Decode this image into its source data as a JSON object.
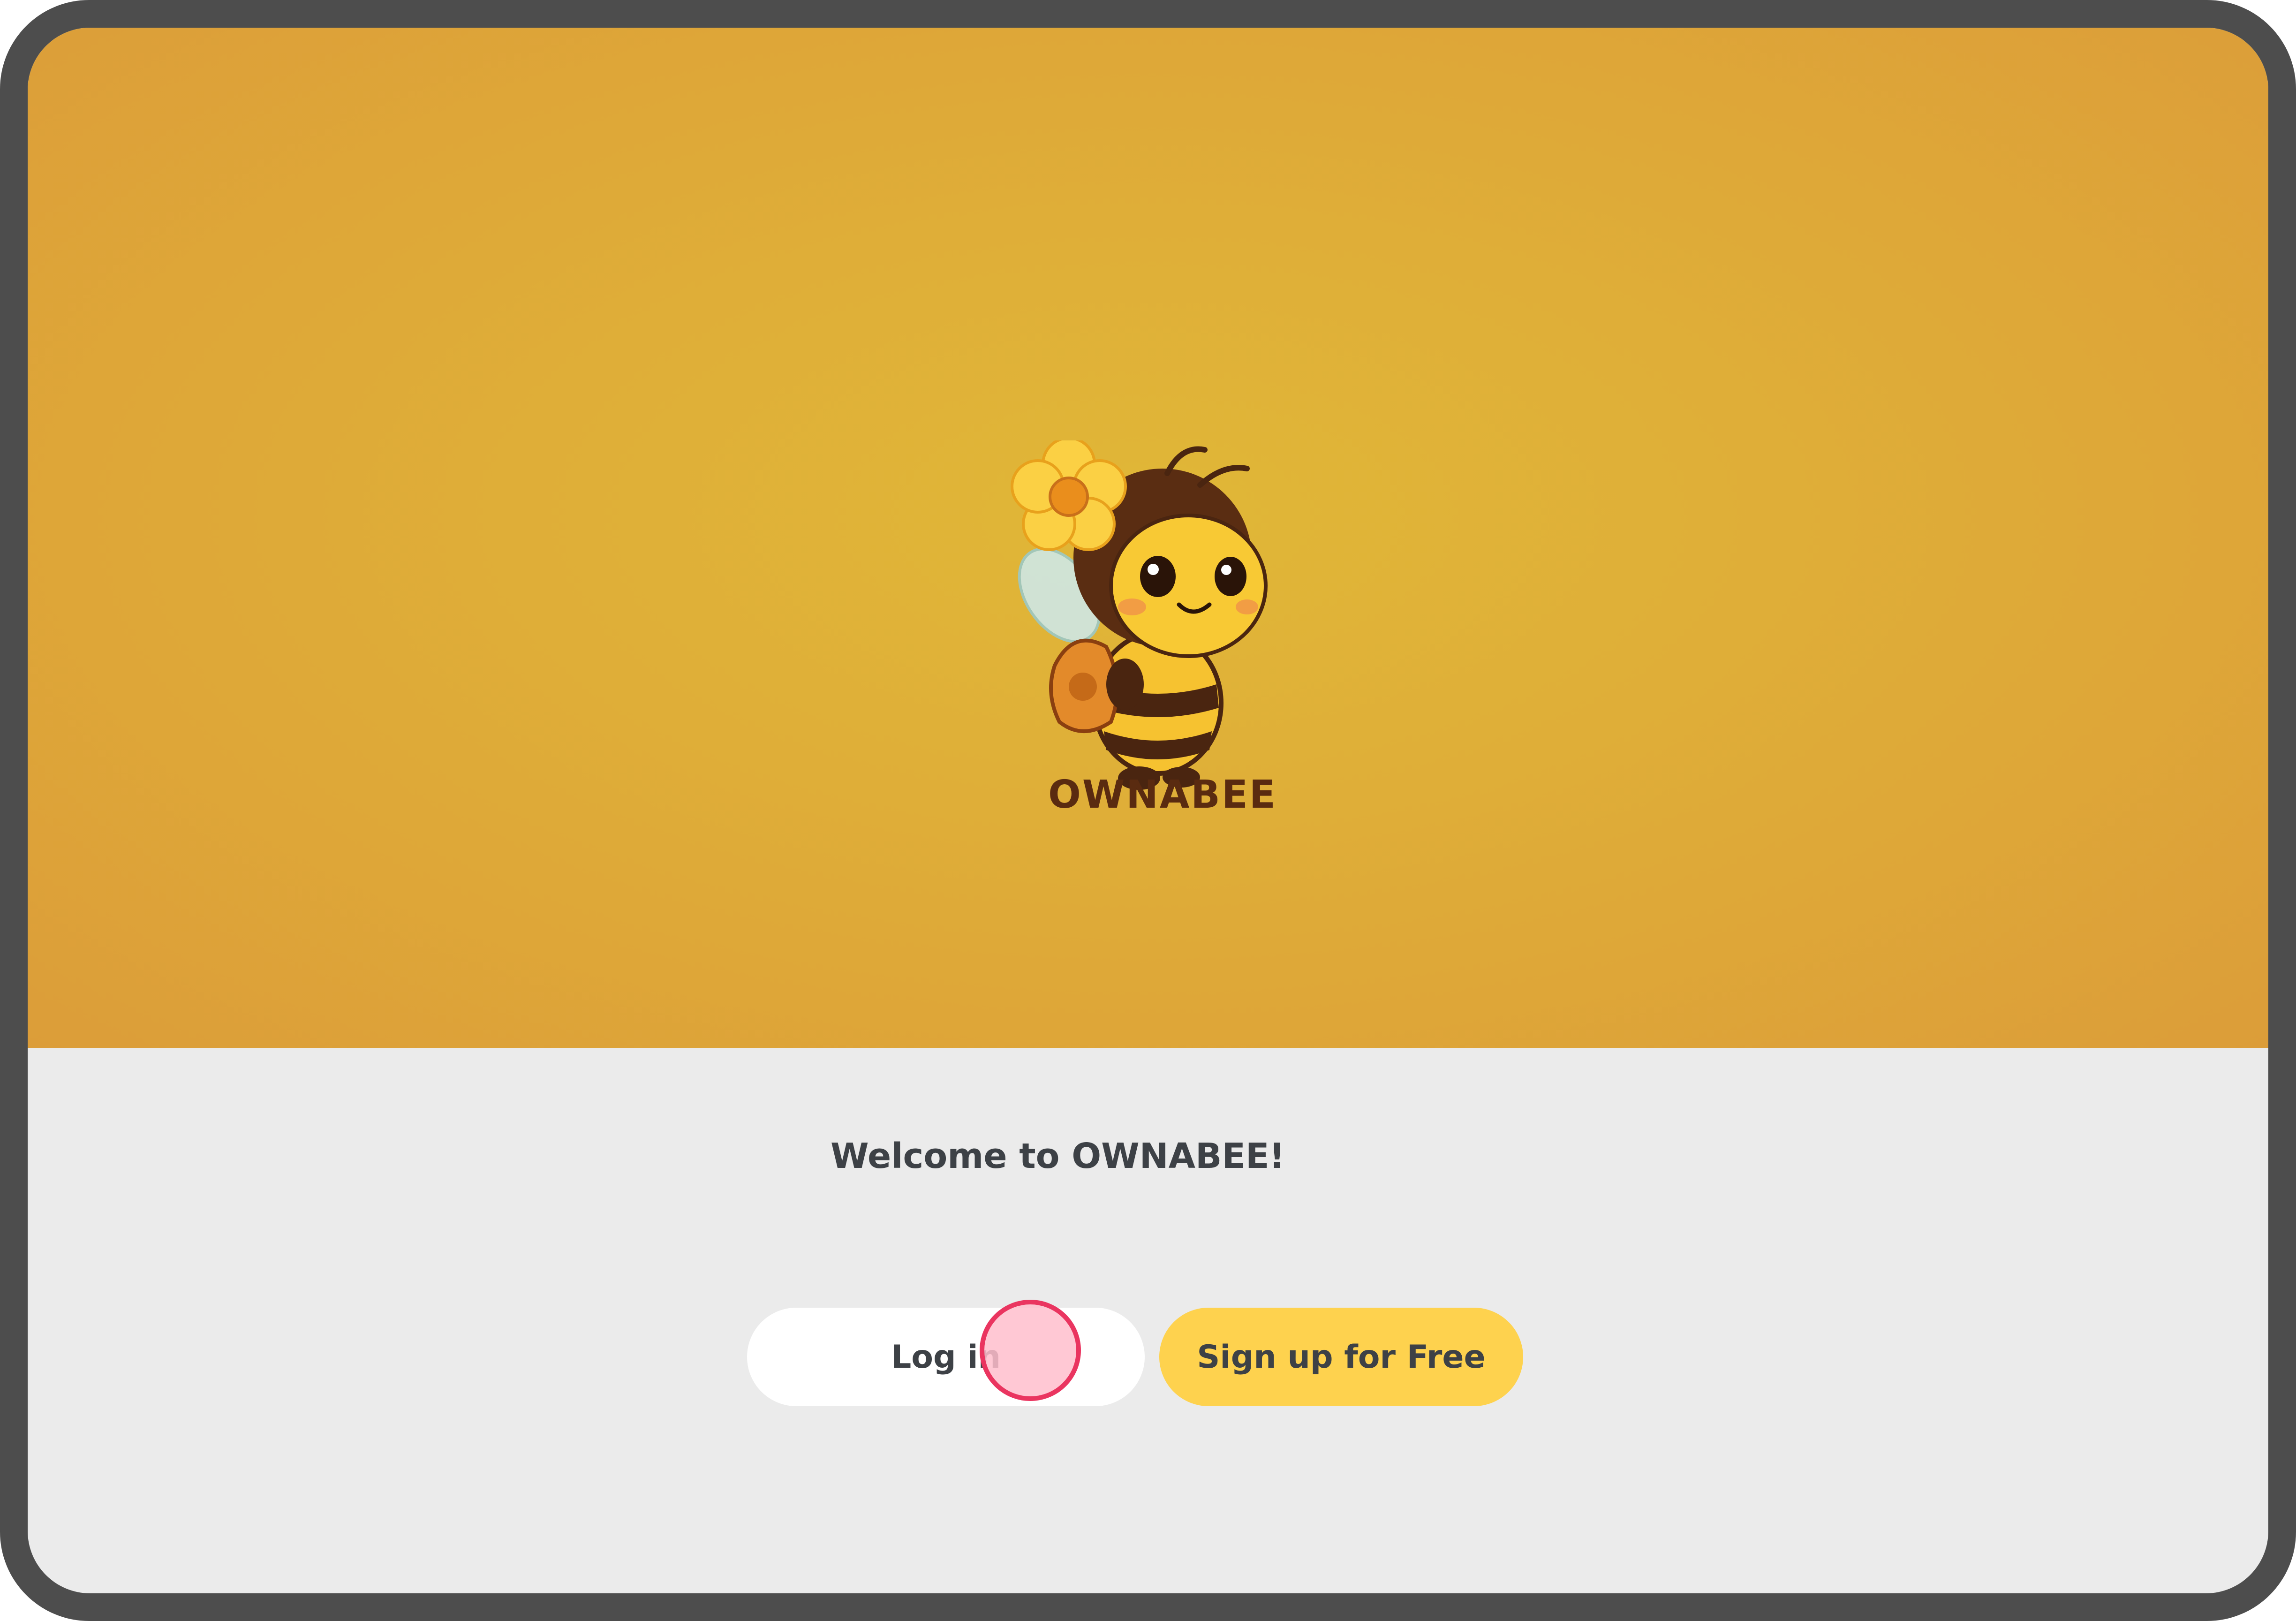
{
  "app": {
    "brand_name": "OWNABEE",
    "logo_icon": "bee-mascot-icon"
  },
  "welcome": {
    "title": "Welcome to OWNABEE!"
  },
  "actions": {
    "login_label": "Log in",
    "signup_label": "Sign up for Free"
  },
  "colors": {
    "hero_background": "#dfae38",
    "page_background": "#ebebeb",
    "signup_button": "#fed24e",
    "login_button": "#ffffff",
    "text": "#3d4146",
    "brand_text": "#5a2b10",
    "frame": "#4d4d4d",
    "click_indicator": "#ea3560"
  }
}
